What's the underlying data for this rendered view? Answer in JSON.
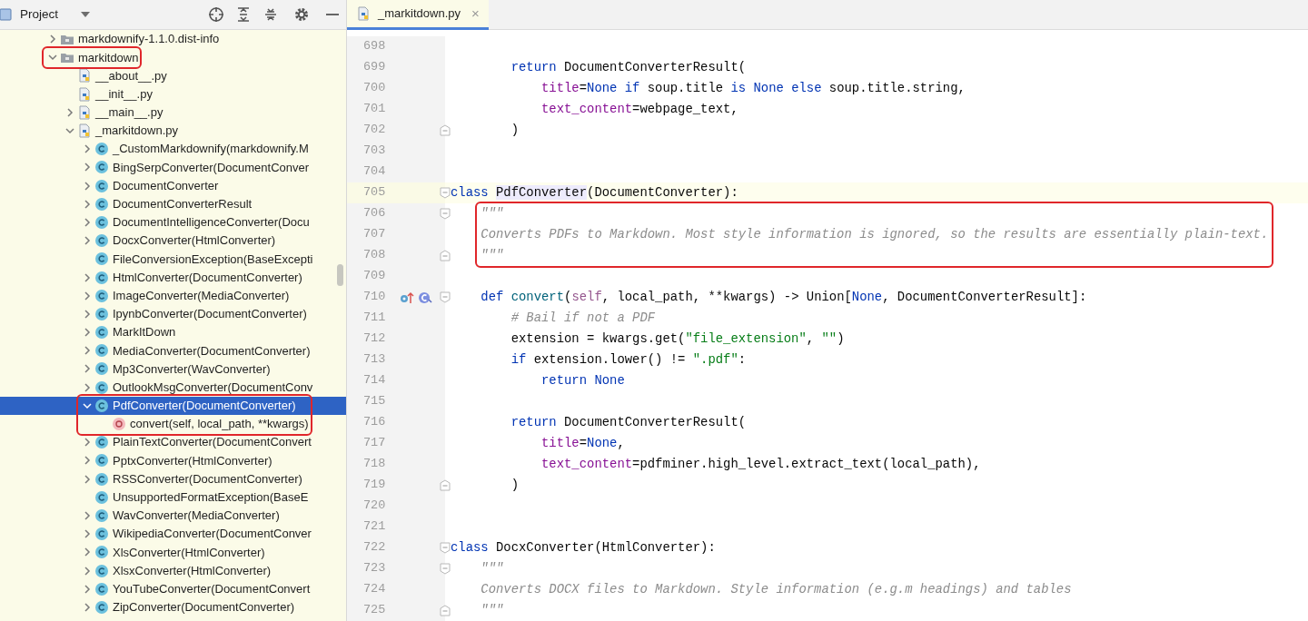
{
  "project_panel": {
    "title": "Project",
    "tree": [
      {
        "label": "markdownify-1.1.0.dist-info",
        "kind": "folder",
        "expanded": false,
        "selected": false,
        "annotated": false
      },
      {
        "label": "markitdown",
        "kind": "folder",
        "expanded": true,
        "selected": false,
        "annotated": true,
        "children": [
          {
            "label": "__about__.py",
            "kind": "pyfile",
            "selected": false,
            "annotated": false
          },
          {
            "label": "__init__.py",
            "kind": "pyfile",
            "selected": false,
            "annotated": false
          },
          {
            "label": "__main__.py",
            "kind": "pyfile",
            "expanded": false,
            "selected": false,
            "annotated": false
          },
          {
            "label": "_markitdown.py",
            "kind": "pyfile",
            "expanded": true,
            "selected": false,
            "annotated": false,
            "children": [
              {
                "label": "_CustomMarkdownify(markdownify.M",
                "kind": "class",
                "expanded": false,
                "selected": false,
                "annotated": false
              },
              {
                "label": "BingSerpConverter(DocumentConver",
                "kind": "class",
                "expanded": false,
                "selected": false,
                "annotated": false
              },
              {
                "label": "DocumentConverter",
                "kind": "class",
                "expanded": false,
                "selected": false,
                "annotated": false
              },
              {
                "label": "DocumentConverterResult",
                "kind": "class",
                "expanded": false,
                "selected": false,
                "annotated": false
              },
              {
                "label": "DocumentIntelligenceConverter(Docu",
                "kind": "class",
                "expanded": false,
                "selected": false,
                "annotated": false
              },
              {
                "label": "DocxConverter(HtmlConverter)",
                "kind": "class",
                "expanded": false,
                "selected": false,
                "annotated": false
              },
              {
                "label": "FileConversionException(BaseExcepti",
                "kind": "class",
                "selected": false,
                "annotated": false
              },
              {
                "label": "HtmlConverter(DocumentConverter)",
                "kind": "class",
                "expanded": false,
                "selected": false,
                "annotated": false
              },
              {
                "label": "ImageConverter(MediaConverter)",
                "kind": "class",
                "expanded": false,
                "selected": false,
                "annotated": false
              },
              {
                "label": "IpynbConverter(DocumentConverter)",
                "kind": "class",
                "expanded": false,
                "selected": false,
                "annotated": false
              },
              {
                "label": "MarkItDown",
                "kind": "class",
                "expanded": false,
                "selected": false,
                "annotated": false
              },
              {
                "label": "MediaConverter(DocumentConverter)",
                "kind": "class",
                "expanded": false,
                "selected": false,
                "annotated": false
              },
              {
                "label": "Mp3Converter(WavConverter)",
                "kind": "class",
                "expanded": false,
                "selected": false,
                "annotated": false
              },
              {
                "label": "OutlookMsgConverter(DocumentConv",
                "kind": "class",
                "expanded": false,
                "selected": false,
                "annotated": false
              },
              {
                "label": "PdfConverter(DocumentConverter)",
                "kind": "class",
                "expanded": true,
                "selected": true,
                "annotated": true,
                "children": [
                  {
                    "label": "convert(self, local_path, **kwargs)",
                    "kind": "method",
                    "selected": false,
                    "annotated": true
                  }
                ]
              },
              {
                "label": "PlainTextConverter(DocumentConvert",
                "kind": "class",
                "expanded": false,
                "selected": false,
                "annotated": false
              },
              {
                "label": "PptxConverter(HtmlConverter)",
                "kind": "class",
                "expanded": false,
                "selected": false,
                "annotated": false
              },
              {
                "label": "RSSConverter(DocumentConverter)",
                "kind": "class",
                "expanded": false,
                "selected": false,
                "annotated": false
              },
              {
                "label": "UnsupportedFormatException(BaseE",
                "kind": "class",
                "selected": false,
                "annotated": false
              },
              {
                "label": "WavConverter(MediaConverter)",
                "kind": "class",
                "expanded": false,
                "selected": false,
                "annotated": false
              },
              {
                "label": "WikipediaConverter(DocumentConver",
                "kind": "class",
                "expanded": false,
                "selected": false,
                "annotated": false
              },
              {
                "label": "XlsConverter(HtmlConverter)",
                "kind": "class",
                "expanded": false,
                "selected": false,
                "annotated": false
              },
              {
                "label": "XlsxConverter(HtmlConverter)",
                "kind": "class",
                "expanded": false,
                "selected": false,
                "annotated": false
              },
              {
                "label": "YouTubeConverter(DocumentConvert",
                "kind": "class",
                "expanded": false,
                "selected": false,
                "annotated": false
              },
              {
                "label": "ZipConverter(DocumentConverter)",
                "kind": "class",
                "expanded": false,
                "selected": false,
                "annotated": false
              }
            ]
          }
        ]
      }
    ]
  },
  "editor": {
    "tabs": [
      {
        "label": "_markitdown.py",
        "close": "×",
        "selected": true
      }
    ],
    "lines": [
      {
        "number": "698",
        "kind": "plain",
        "current": false,
        "annotated": false
      },
      {
        "number": "699",
        "kind": "plain",
        "current": false,
        "annotated": false,
        "tokens": [
          {
            "text": "        return",
            "kind": "keyword"
          },
          {
            "text": " DocumentConverterResult(",
            "kind": "plain"
          }
        ]
      },
      {
        "number": "700",
        "kind": "plain",
        "current": false,
        "annotated": false,
        "tokens": [
          {
            "text": "            title",
            "kind": "param"
          },
          {
            "text": "=",
            "kind": "plain"
          },
          {
            "text": "None if",
            "kind": "keyword"
          },
          {
            "text": " soup.title ",
            "kind": "plain"
          },
          {
            "text": "is None else",
            "kind": "keyword"
          },
          {
            "text": " soup.title.string,",
            "kind": "plain"
          }
        ]
      },
      {
        "number": "701",
        "kind": "plain",
        "current": false,
        "annotated": false,
        "tokens": [
          {
            "text": "            text_content",
            "kind": "param"
          },
          {
            "text": "=webpage_text,",
            "kind": "plain"
          }
        ]
      },
      {
        "number": "702",
        "kind": "fold-end",
        "current": false,
        "annotated": false,
        "tokens": [
          {
            "text": "        )",
            "kind": "plain"
          }
        ]
      },
      {
        "number": "703",
        "kind": "plain",
        "current": false,
        "annotated": false
      },
      {
        "number": "704",
        "kind": "plain",
        "current": false,
        "annotated": false
      },
      {
        "number": "705",
        "kind": "fold-start",
        "current": true,
        "annotated": false,
        "tokens": [
          {
            "text": "class ",
            "kind": "keyword"
          },
          {
            "text": "PdfConverter",
            "kind": "usage"
          },
          {
            "text": "(DocumentConverter):",
            "kind": "plain"
          }
        ]
      },
      {
        "number": "706",
        "kind": "fold-start",
        "current": false,
        "annotated": true,
        "tokens": [
          {
            "text": "    \"\"\"",
            "kind": "docstring"
          }
        ]
      },
      {
        "number": "707",
        "kind": "plain",
        "current": false,
        "annotated": true,
        "tokens": [
          {
            "text": "    Converts PDFs to Markdown. Most style information is ignored, so the results are essentially plain-text.",
            "kind": "docstring"
          }
        ]
      },
      {
        "number": "708",
        "kind": "fold-end",
        "current": false,
        "annotated": true,
        "tokens": [
          {
            "text": "    \"\"\"",
            "kind": "docstring"
          }
        ]
      },
      {
        "number": "709",
        "kind": "plain",
        "current": false,
        "annotated": false
      },
      {
        "number": "710",
        "kind": "method-def",
        "current": false,
        "annotated": false,
        "tokens": [
          {
            "text": "    def ",
            "kind": "keyword"
          },
          {
            "text": "convert",
            "kind": "function"
          },
          {
            "text": "(",
            "kind": "plain"
          },
          {
            "text": "self",
            "kind": "self"
          },
          {
            "text": ", local_path, **kwargs) -> Union[",
            "kind": "plain"
          },
          {
            "text": "None",
            "kind": "keyword"
          },
          {
            "text": ", DocumentConverterResult]:",
            "kind": "plain"
          }
        ]
      },
      {
        "number": "711",
        "kind": "plain",
        "current": false,
        "annotated": false,
        "tokens": [
          {
            "text": "        # Bail if not a PDF",
            "kind": "comment"
          }
        ]
      },
      {
        "number": "712",
        "kind": "plain",
        "current": false,
        "annotated": false,
        "tokens": [
          {
            "text": "        extension = kwargs.get(",
            "kind": "plain"
          },
          {
            "text": "\"file_extension\"",
            "kind": "string"
          },
          {
            "text": ", ",
            "kind": "plain"
          },
          {
            "text": "\"\"",
            "kind": "string"
          },
          {
            "text": ")",
            "kind": "plain"
          }
        ]
      },
      {
        "number": "713",
        "kind": "plain",
        "current": false,
        "annotated": false,
        "tokens": [
          {
            "text": "        if",
            "kind": "keyword"
          },
          {
            "text": " extension.lower() != ",
            "kind": "plain"
          },
          {
            "text": "\".pdf\"",
            "kind": "string"
          },
          {
            "text": ":",
            "kind": "plain"
          }
        ]
      },
      {
        "number": "714",
        "kind": "plain",
        "current": false,
        "annotated": false,
        "tokens": [
          {
            "text": "            return None",
            "kind": "keyword"
          }
        ]
      },
      {
        "number": "715",
        "kind": "plain",
        "current": false,
        "annotated": false
      },
      {
        "number": "716",
        "kind": "plain",
        "current": false,
        "annotated": false,
        "tokens": [
          {
            "text": "        return",
            "kind": "keyword"
          },
          {
            "text": " DocumentConverterResult(",
            "kind": "plain"
          }
        ]
      },
      {
        "number": "717",
        "kind": "plain",
        "current": false,
        "annotated": false,
        "tokens": [
          {
            "text": "            title",
            "kind": "param"
          },
          {
            "text": "=",
            "kind": "plain"
          },
          {
            "text": "None",
            "kind": "keyword"
          },
          {
            "text": ",",
            "kind": "plain"
          }
        ]
      },
      {
        "number": "718",
        "kind": "plain",
        "current": false,
        "annotated": false,
        "tokens": [
          {
            "text": "            text_content",
            "kind": "param"
          },
          {
            "text": "=pdfminer.high_level.extract_text(local_path),",
            "kind": "plain"
          }
        ]
      },
      {
        "number": "719",
        "kind": "fold-end",
        "current": false,
        "annotated": false,
        "tokens": [
          {
            "text": "        )",
            "kind": "plain"
          }
        ]
      },
      {
        "number": "720",
        "kind": "plain",
        "current": false,
        "annotated": false
      },
      {
        "number": "721",
        "kind": "plain",
        "current": false,
        "annotated": false
      },
      {
        "number": "722",
        "kind": "fold-start",
        "current": false,
        "annotated": false,
        "tokens": [
          {
            "text": "class",
            "kind": "keyword"
          },
          {
            "text": " DocxConverter(HtmlConverter):",
            "kind": "plain"
          }
        ]
      },
      {
        "number": "723",
        "kind": "fold-start",
        "current": false,
        "annotated": false,
        "tokens": [
          {
            "text": "    \"\"\"",
            "kind": "docstring"
          }
        ]
      },
      {
        "number": "724",
        "kind": "plain",
        "current": false,
        "annotated": false,
        "tokens": [
          {
            "text": "    Converts DOCX files to Markdown. Style information (e.g.m headings) and tables",
            "kind": "docstring"
          }
        ]
      },
      {
        "number": "725",
        "kind": "fold-end",
        "current": false,
        "annotated": false,
        "tokens": [
          {
            "text": "    \"\"\"",
            "kind": "docstring"
          }
        ]
      }
    ]
  }
}
